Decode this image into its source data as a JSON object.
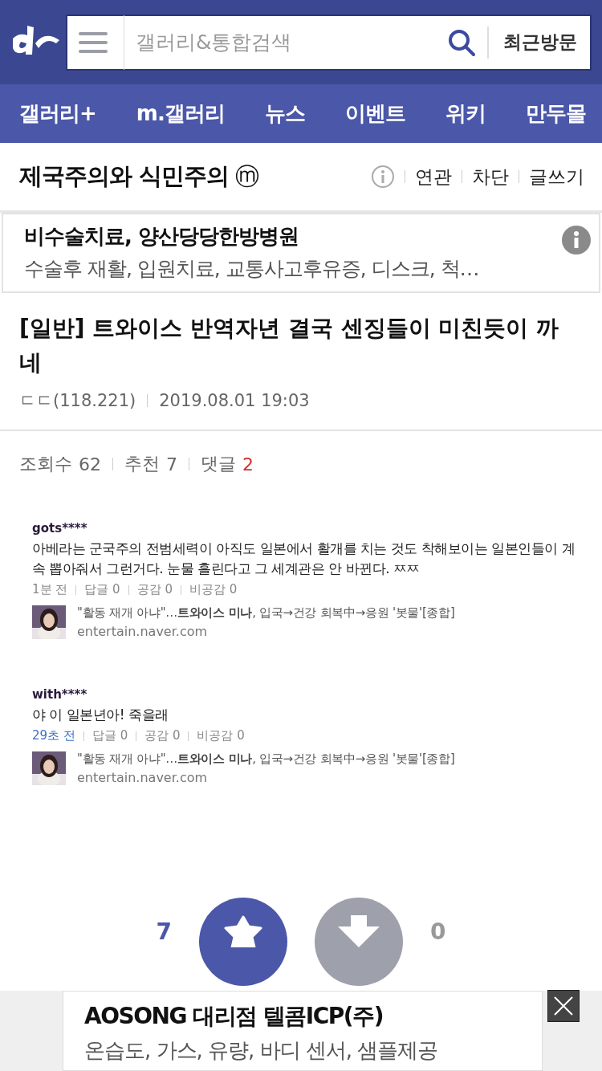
{
  "header": {
    "search": {
      "placeholder": "갤러리&통합검색"
    },
    "recent_button": "최근방문"
  },
  "nav": {
    "items": [
      {
        "label": "갤러리+"
      },
      {
        "label": "m.갤러리"
      },
      {
        "label": "뉴스"
      },
      {
        "label": "이벤트"
      },
      {
        "label": "위키"
      },
      {
        "label": "만두몰"
      }
    ]
  },
  "gallery": {
    "title": "제국주의와 식민주의",
    "badge": "ⓜ",
    "actions": [
      "연관",
      "차단",
      "글쓰기"
    ]
  },
  "top_ad": {
    "title": "비수술치료, 양산당당한방병원",
    "text": "수술후 재활, 입원치료, 교통사고후유증, 디스크, 척…"
  },
  "post": {
    "title": "[일반] 트와이스 반역자년 결국 센징들이 미친듯이 까네",
    "author": "ㄷㄷ(118.221)",
    "date": "2019.08.01 19:03",
    "stats": [
      {
        "label": "조회수",
        "value": "62",
        "highlight": false
      },
      {
        "label": "추천",
        "value": "7",
        "highlight": false
      },
      {
        "label": "댓글",
        "value": "2",
        "highlight": true
      }
    ]
  },
  "comments": [
    {
      "user": "gots****",
      "text": "아베라는 군국주의 전범세력이 아직도 일본에서 활개를 치는 것도 착해보이는 일본인들이 계속 뽑아줘서 그런거다. 눈물 흘린다고 그 세계관은 안 바뀐다. ㅉㅉ",
      "time": "1분 전",
      "recent": false,
      "meta": [
        "답글 0",
        "공감 0",
        "비공감 0"
      ],
      "link": {
        "title_start": "\"활동 재개 아냐\"…",
        "title_bold": "트와이스 미나",
        "title_end": ", 입국→건강 회복中→응원 '봇물'[종합]",
        "site": "entertain.naver.com"
      }
    },
    {
      "user": "with****",
      "text": "야 이 일본년아! 죽을래",
      "time": "29초 전",
      "recent": true,
      "meta": [
        "답글 0",
        "공감 0",
        "비공감 0"
      ],
      "link": {
        "title_start": "\"활동 재개 아냐\"…",
        "title_bold": "트와이스 미나",
        "title_end": ", 입국→건강 회복中→응원 '봇물'[종합]",
        "site": "entertain.naver.com"
      }
    }
  ],
  "votes": {
    "up": "7",
    "down": "0"
  },
  "bottom_ad": {
    "title": "AOSONG 대리점 텔콤ICP(주)",
    "text": "온습도, 가스, 유량, 바디 센서, 샘플제공"
  }
}
